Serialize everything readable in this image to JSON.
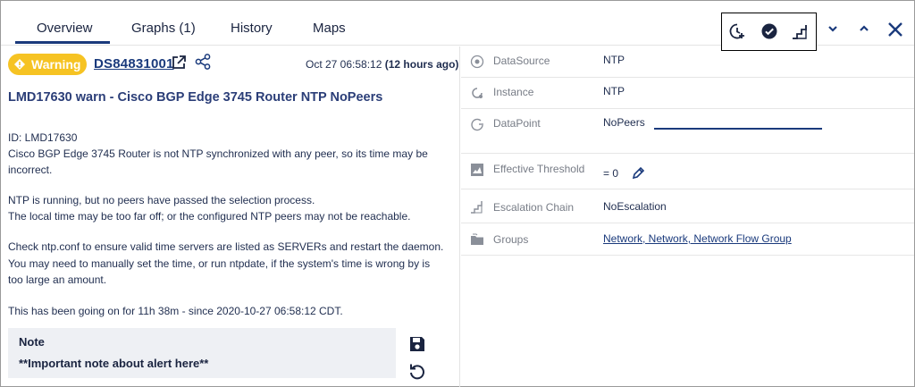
{
  "tabs": [
    {
      "label": "Overview",
      "active": true
    },
    {
      "label": "Graphs (1)",
      "active": false
    },
    {
      "label": "History",
      "active": false
    },
    {
      "label": "Maps",
      "active": false
    }
  ],
  "actions": {
    "icons": [
      "ack-clock-icon",
      "ack-check-icon",
      "escalate-stairs-icon"
    ],
    "controls": [
      "chevron-down-icon",
      "chevron-up-icon",
      "close-icon"
    ]
  },
  "alert": {
    "severity": "Warning",
    "severity_color": "#f6c323",
    "id_link": "DS84831001",
    "timestamp": "Oct 27 06:58:12",
    "age": "(12 hours ago)",
    "title": "LMD17630 warn - Cisco BGP Edge 3745 Router NTP NoPeers",
    "description_lines": [
      "ID: LMD17630",
      "Cisco BGP Edge 3745 Router is not NTP synchronized with any peer, so its time may be",
      "incorrect.",
      "NTP is running, but no peers have passed the selection process.",
      "The local time may be too far off; or the configured NTP peers may not be reachable.",
      "Check ntp.conf to ensure valid time servers are listed as SERVERs and restart the daemon.",
      "You may need to manually set the time, or run ntpdate, if the system's time is wrong by is",
      "too large an amount.",
      "This has been going on for 11h 38m - since 2020-10-27 06:58:12 CDT."
    ]
  },
  "note": {
    "label": "Note",
    "text": "**Important note about alert here**"
  },
  "details": [
    {
      "label": "DataSource",
      "value": "NTP",
      "icon": "datasource-icon"
    },
    {
      "label": "Instance",
      "value": "NTP",
      "icon": "instance-icon"
    },
    {
      "label": "DataPoint",
      "value": "NoPeers",
      "icon": "datapoint-icon"
    },
    {
      "label": "Effective Threshold",
      "value": "= 0",
      "icon": "threshold-icon"
    },
    {
      "label": "Escalation Chain",
      "value": "NoEscalation",
      "icon": "escalation-icon"
    },
    {
      "label": "Groups",
      "value": "Network, Network, Network Flow Group",
      "icon": "folder-icon"
    }
  ],
  "colors": {
    "accent": "#1a3a7c",
    "warning": "#f6c323"
  }
}
